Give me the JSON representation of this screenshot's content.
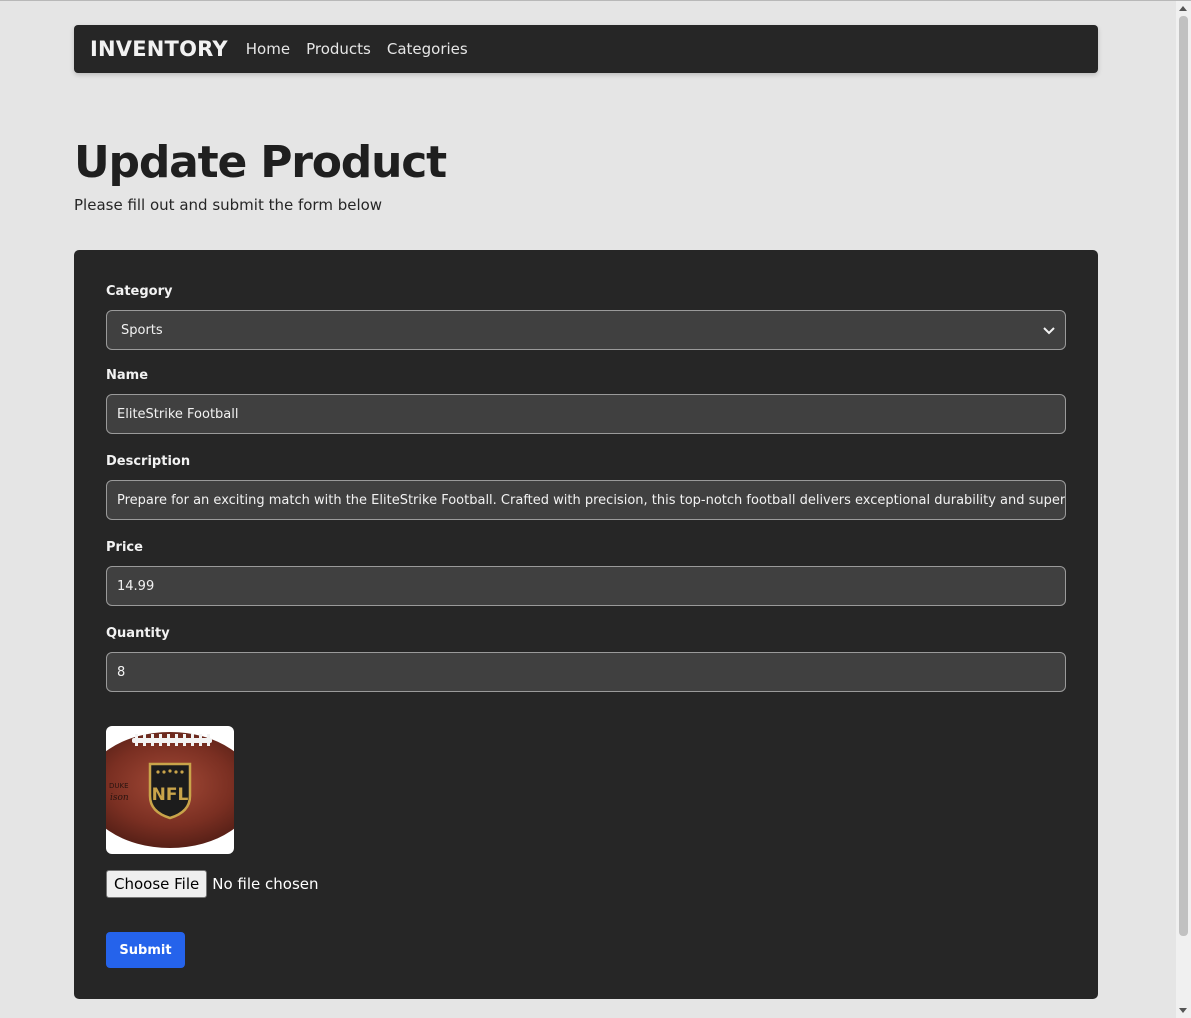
{
  "nav": {
    "brand": "INVENTORY",
    "links": [
      "Home",
      "Products",
      "Categories"
    ]
  },
  "header": {
    "title": "Update Product",
    "subtitle": "Please fill out and submit the form below"
  },
  "form": {
    "category": {
      "label": "Category",
      "value": "Sports"
    },
    "name": {
      "label": "Name",
      "value": "EliteStrike Football"
    },
    "description": {
      "label": "Description",
      "value": "Prepare for an exciting match with the EliteStrike Football. Crafted with precision, this top-notch football delivers exceptional durability and superior"
    },
    "price": {
      "label": "Price",
      "value": "14.99"
    },
    "quantity": {
      "label": "Quantity",
      "value": "8"
    },
    "image": {
      "logo_text": "NFL",
      "icon": "football-image"
    },
    "file": {
      "button_label": "Choose File",
      "status": "No file chosen"
    },
    "submit_label": "Submit"
  },
  "colors": {
    "background": "#e5e5e5",
    "navbar": "#262626",
    "card": "#262626",
    "field": "#404040",
    "accent": "#2563eb"
  }
}
